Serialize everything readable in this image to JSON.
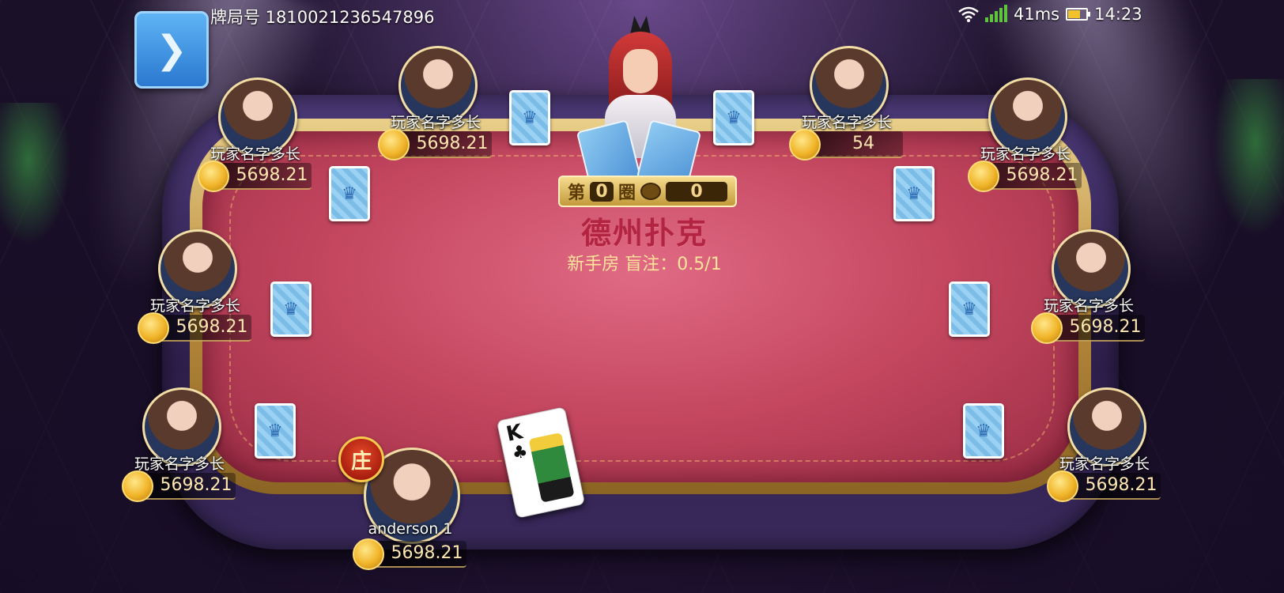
{
  "top_bar": {
    "back_icon": "chevron-right",
    "room_id_label": "牌局号 1810021236547896",
    "latency": "41ms",
    "clock": "14:23"
  },
  "table": {
    "round_label_prefix": "第",
    "round_number": "0",
    "round_label_suffix": "圈",
    "pot_value": "0",
    "game_title": "德州扑克",
    "blind_info": "新手房 盲注：0.5/1"
  },
  "players": [
    {
      "name": "玩家名字多长",
      "chips": "5698.21"
    },
    {
      "name": "玩家名字多长",
      "chips": "5698.21"
    },
    {
      "name": "玩家名字多长",
      "chips": "54"
    },
    {
      "name": "玩家名字多长",
      "chips": "5698.21"
    },
    {
      "name": "玩家名字多长",
      "chips": "5698.21"
    },
    {
      "name": "玩家名字多长",
      "chips": "5698.21"
    },
    {
      "name": "玩家名字多长",
      "chips": "5698.21"
    },
    {
      "name": "玩家名字多长",
      "chips": "5698.21"
    },
    {
      "name": "anderson 1",
      "chips": "5698.21"
    }
  ],
  "banker_badge": "庄",
  "face_up_card": {
    "rank": "K",
    "suit": "♣"
  },
  "colors": {
    "felt": "#c4465f",
    "gold_trim": "#e9cf89",
    "back_button": "#2a78d0",
    "chip_text": "#fbe6b0"
  }
}
